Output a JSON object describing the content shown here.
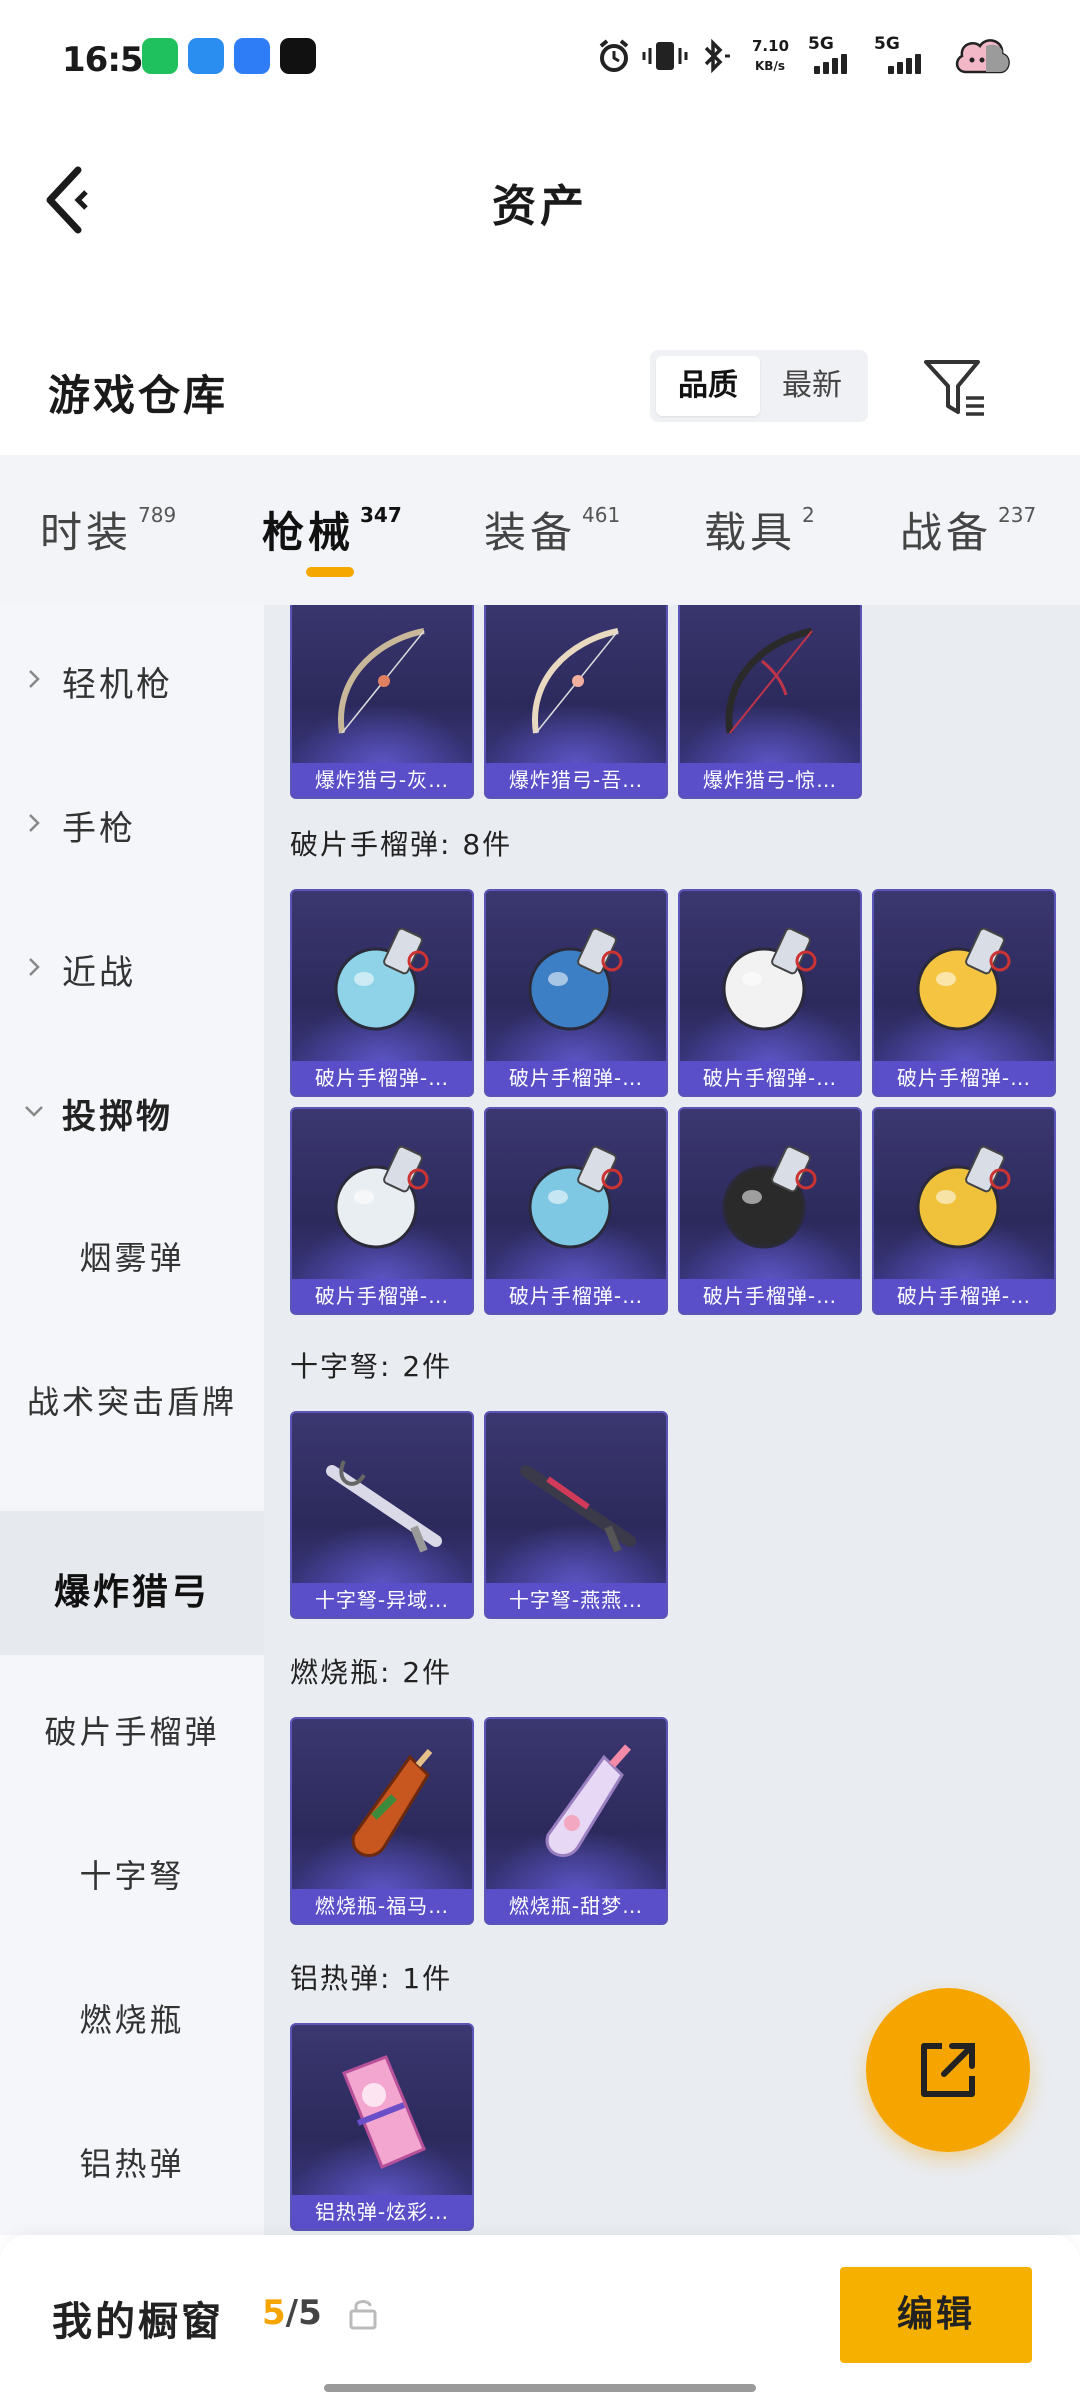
{
  "status_bar": {
    "time": "16:51",
    "speed_value": "7.10",
    "speed_unit": "KB/s",
    "net1": "5G",
    "net2": "5G",
    "app_icons": [
      "wechat-icon",
      "browser-icon",
      "files-icon",
      "deyin-icon"
    ],
    "app_icon_colors": [
      "#1fc15f",
      "#2a8ef0",
      "#2f7df6",
      "#111111"
    ]
  },
  "header": {
    "title": "资产"
  },
  "section": {
    "title": "游戏仓库",
    "sort_options": [
      "品质",
      "最新"
    ],
    "active_sort": "品质"
  },
  "tabs": [
    {
      "label": "时装",
      "count": "789"
    },
    {
      "label": "枪械",
      "count": "347",
      "active": true
    },
    {
      "label": "装备",
      "count": "461"
    },
    {
      "label": "载具",
      "count": "2"
    },
    {
      "label": "战备",
      "count": "237"
    }
  ],
  "sidebar": {
    "items": [
      {
        "label": "轻机枪",
        "type": "parent"
      },
      {
        "label": "手枪",
        "type": "parent"
      },
      {
        "label": "近战",
        "type": "parent"
      },
      {
        "label": "投掷物",
        "type": "expanded"
      },
      {
        "label": "烟雾弹",
        "type": "child"
      },
      {
        "label": "战术突击盾牌",
        "type": "child"
      },
      {
        "label": "爆炸猎弓",
        "type": "child",
        "active": true
      },
      {
        "label": "破片手榴弹",
        "type": "child"
      },
      {
        "label": "十字弩",
        "type": "child"
      },
      {
        "label": "燃烧瓶",
        "type": "child"
      },
      {
        "label": "铝热弹",
        "type": "child"
      }
    ]
  },
  "groups": [
    {
      "title": "",
      "items": [
        "爆炸猎弓-灰…",
        "爆炸猎弓-吾…",
        "爆炸猎弓-惊…"
      ],
      "icon": "bow-icon"
    },
    {
      "title": "破片手榴弹: 8件",
      "items": [
        "破片手榴弹-…",
        "破片手榴弹-…",
        "破片手榴弹-…",
        "破片手榴弹-…",
        "破片手榴弹-…",
        "破片手榴弹-…",
        "破片手榴弹-…",
        "破片手榴弹-…"
      ],
      "icon": "grenade-icon",
      "colors": [
        "#8fd3e8",
        "#3d7fc4",
        "#f2f2f2",
        "#f5c542",
        "#e9eef2",
        "#7ec8e3",
        "#2a2a2a",
        "#f0c23b"
      ]
    },
    {
      "title": "十字弩: 2件",
      "items": [
        "十字弩-异域…",
        "十字弩-燕燕…"
      ],
      "icon": "crossbow-icon"
    },
    {
      "title": "燃烧瓶: 2件",
      "items": [
        "燃烧瓶-福马…",
        "燃烧瓶-甜梦…"
      ],
      "icon": "molotov-icon",
      "colors": [
        "#c8571f",
        "#e7d8f5"
      ]
    },
    {
      "title": "铝热弹: 1件",
      "items": [
        "铝热弹-炫彩…"
      ],
      "icon": "thermite-icon"
    }
  ],
  "bottom": {
    "showcase_title": "我的橱窗",
    "count_current": "5",
    "count_total": "/5",
    "edit_label": "编辑"
  },
  "colors": {
    "accent": "#f5a400",
    "card_bg": "#2c2a5c",
    "card_label_bg": "#5a4fc9"
  }
}
